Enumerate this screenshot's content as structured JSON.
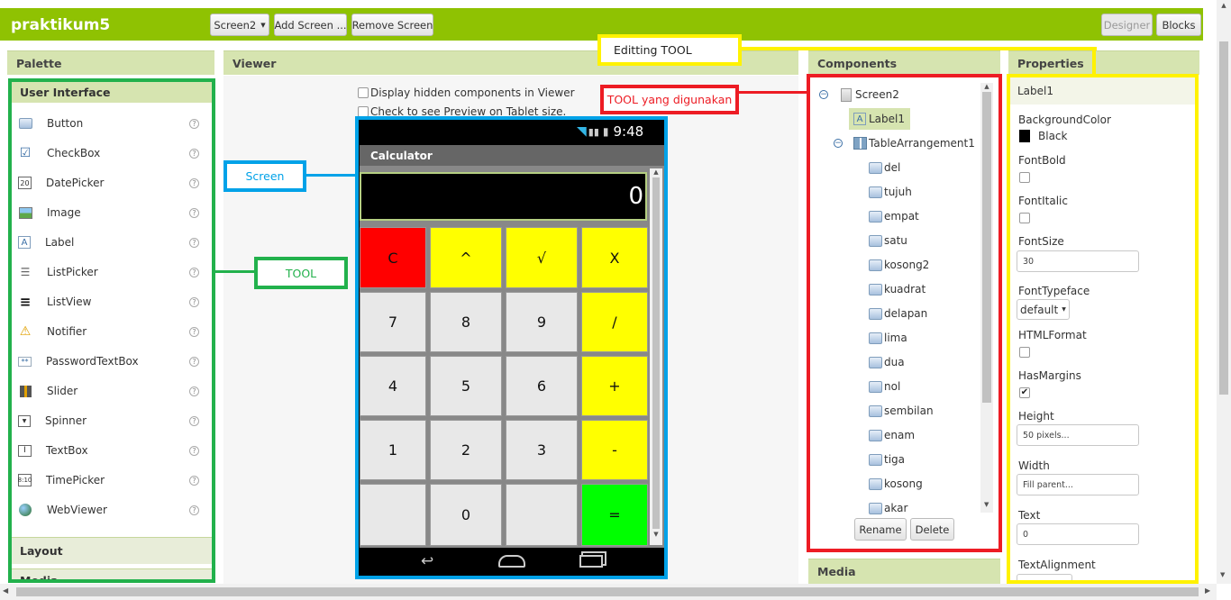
{
  "app": {
    "title": "praktikum5"
  },
  "toolbar": {
    "screen_select": "Screen2",
    "add_screen": "Add Screen ...",
    "remove_screen": "Remove Screen",
    "designer": "Designer",
    "blocks": "Blocks"
  },
  "palette": {
    "header": "Palette",
    "category": "User Interface",
    "items": [
      {
        "label": "Button",
        "icon": "button-icon"
      },
      {
        "label": "CheckBox",
        "icon": "checkbox-icon"
      },
      {
        "label": "DatePicker",
        "icon": "datepicker-icon"
      },
      {
        "label": "Image",
        "icon": "image-icon"
      },
      {
        "label": "Label",
        "icon": "label-icon"
      },
      {
        "label": "ListPicker",
        "icon": "listpicker-icon"
      },
      {
        "label": "ListView",
        "icon": "listview-icon"
      },
      {
        "label": "Notifier",
        "icon": "notifier-icon"
      },
      {
        "label": "PasswordTextBox",
        "icon": "passwordtextbox-icon"
      },
      {
        "label": "Slider",
        "icon": "slider-icon"
      },
      {
        "label": "Spinner",
        "icon": "spinner-icon"
      },
      {
        "label": "TextBox",
        "icon": "textbox-icon"
      },
      {
        "label": "TimePicker",
        "icon": "timepicker-icon"
      },
      {
        "label": "WebViewer",
        "icon": "webviewer-icon"
      }
    ],
    "layout": "Layout",
    "media": "Media"
  },
  "viewer": {
    "header": "Viewer",
    "hidden_label": "Display hidden components in Viewer",
    "tablet_label": "Check to see Preview on Tablet size."
  },
  "phone": {
    "time": "9:48",
    "app_title": "Calculator",
    "display": "0",
    "buttons": [
      {
        "label": "C",
        "color": "#ff0000"
      },
      {
        "label": "^",
        "color": "#ffff00"
      },
      {
        "label": "√",
        "color": "#ffff00"
      },
      {
        "label": "X",
        "color": "#ffff00"
      },
      {
        "label": "7",
        "color": "#e8e8e8"
      },
      {
        "label": "8",
        "color": "#e8e8e8"
      },
      {
        "label": "9",
        "color": "#e8e8e8"
      },
      {
        "label": "/",
        "color": "#ffff00"
      },
      {
        "label": "4",
        "color": "#e8e8e8"
      },
      {
        "label": "5",
        "color": "#e8e8e8"
      },
      {
        "label": "6",
        "color": "#e8e8e8"
      },
      {
        "label": "+",
        "color": "#ffff00"
      },
      {
        "label": "1",
        "color": "#e8e8e8"
      },
      {
        "label": "2",
        "color": "#e8e8e8"
      },
      {
        "label": "3",
        "color": "#e8e8e8"
      },
      {
        "label": "-",
        "color": "#ffff00"
      },
      {
        "label": "",
        "color": "#e8e8e8"
      },
      {
        "label": "0",
        "color": "#e8e8e8"
      },
      {
        "label": "",
        "color": "#e8e8e8"
      },
      {
        "label": "=",
        "color": "#00ff00"
      }
    ]
  },
  "components": {
    "header": "Components",
    "root": "Screen2",
    "label1": "Label1",
    "table": "TableArrangement1",
    "children": [
      "del",
      "tujuh",
      "empat",
      "satu",
      "kosong2",
      "kuadrat",
      "delapan",
      "lima",
      "dua",
      "nol",
      "sembilan",
      "enam",
      "tiga",
      "kosong",
      "akar"
    ],
    "rename": "Rename",
    "delete": "Delete",
    "media": "Media"
  },
  "properties": {
    "header": "Properties",
    "component": "Label1",
    "background_color_label": "BackgroundColor",
    "background_color_value": "Black",
    "fontbold_label": "FontBold",
    "fontitalic_label": "FontItalic",
    "fontsize_label": "FontSize",
    "fontsize_value": "30",
    "fonttypeface_label": "FontTypeface",
    "fonttypeface_value": "default",
    "htmlformat_label": "HTMLFormat",
    "hasmargins_label": "HasMargins",
    "height_label": "Height",
    "height_value": "50 pixels...",
    "width_label": "Width",
    "width_value": "Fill parent...",
    "text_label": "Text",
    "text_value": "0",
    "textalignment_label": "TextAlignment"
  },
  "annotations": {
    "editing": "Editting TOOL",
    "used": "TOOL yang digunakan",
    "screen": "Screen",
    "tool": "TOOL"
  },
  "colors": {
    "green_bar": "#8fc202",
    "green_anno": "#22b14c",
    "blue_anno": "#00a2e8",
    "red_anno": "#ed1c24",
    "yellow_anno": "#fff200"
  }
}
